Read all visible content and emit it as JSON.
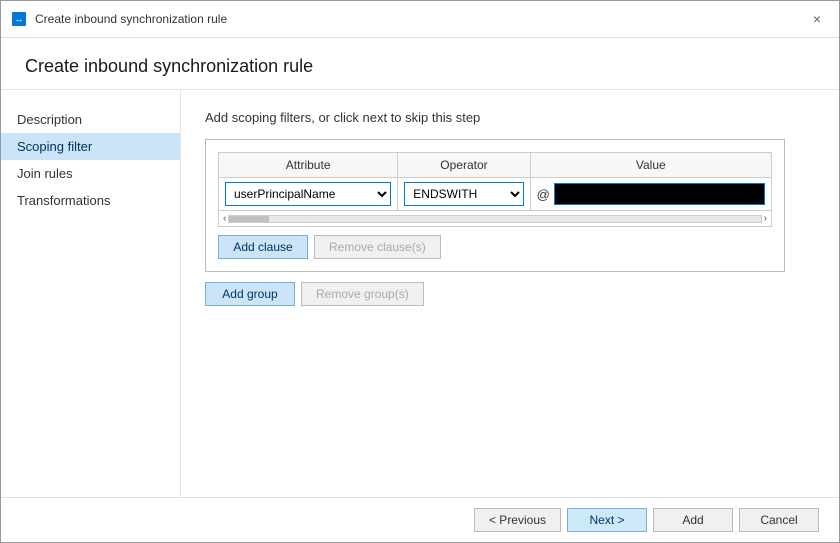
{
  "window": {
    "title": "Create inbound synchronization rule",
    "close_label": "×"
  },
  "page_title": "Create inbound synchronization rule",
  "panel": {
    "subtitle": "Add scoping filters, or click next to skip this step"
  },
  "sidebar": {
    "items": [
      {
        "id": "description",
        "label": "Description",
        "active": false
      },
      {
        "id": "scoping-filter",
        "label": "Scoping filter",
        "active": true
      },
      {
        "id": "join-rules",
        "label": "Join rules",
        "active": false
      },
      {
        "id": "transformations",
        "label": "Transformations",
        "active": false
      }
    ]
  },
  "filter_table": {
    "headers": [
      "Attribute",
      "Operator",
      "Value"
    ],
    "attribute_options": [
      "userPrincipalName"
    ],
    "operator_options": [
      "ENDSWITH"
    ],
    "selected_attribute": "userPrincipalName",
    "selected_operator": "ENDSWITH",
    "value_prefix": "@",
    "value_placeholder": ""
  },
  "buttons": {
    "add_clause": "Add clause",
    "remove_clause": "Remove clause(s)",
    "add_group": "Add group",
    "remove_group": "Remove group(s)"
  },
  "footer": {
    "previous_label": "< Previous",
    "next_label": "Next >",
    "add_label": "Add",
    "cancel_label": "Cancel"
  }
}
